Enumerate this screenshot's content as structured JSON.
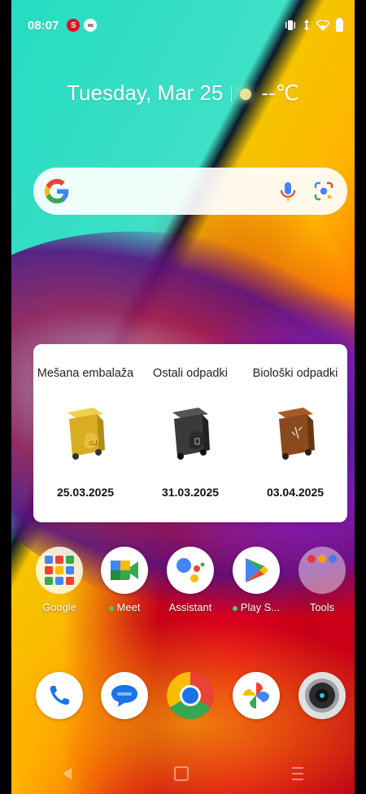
{
  "status_bar": {
    "time": "08:07",
    "left_icons": [
      "swirl-notification-icon",
      "wear-notification-icon"
    ],
    "right_icons": [
      "vibrate-icon",
      "data-transfer-icon",
      "wifi-icon",
      "battery-icon"
    ]
  },
  "clock_widget": {
    "date": "Tuesday, Mar 25",
    "temperature": "--℃"
  },
  "search_bar": {
    "icons": [
      "google-g-icon",
      "mic-icon",
      "lens-icon"
    ]
  },
  "waste_widget": {
    "bins": [
      {
        "label": "Mešana embalaža",
        "date": "25.03.2025",
        "color": "#e7bd2a"
      },
      {
        "label": "Ostali odpadki",
        "date": "31.03.2025",
        "color": "#3a3a3a"
      },
      {
        "label": "Biološki odpadki",
        "date": "03.04.2025",
        "color": "#8a4a1e"
      }
    ]
  },
  "app_row": [
    {
      "name": "Google",
      "kind": "folder"
    },
    {
      "name": "Meet",
      "dot": true
    },
    {
      "name": "Assistant"
    },
    {
      "name": "Play S...",
      "dot": true
    },
    {
      "name": "Tools",
      "kind": "folder"
    }
  ],
  "dock": [
    "phone-icon",
    "messages-icon",
    "chrome-icon",
    "photos-icon",
    "camera-icon"
  ],
  "colors": {
    "accent_red": "#e01020",
    "google_blue": "#4285F4",
    "google_red": "#EA4335",
    "google_yellow": "#FBBC05",
    "google_green": "#34A853"
  }
}
